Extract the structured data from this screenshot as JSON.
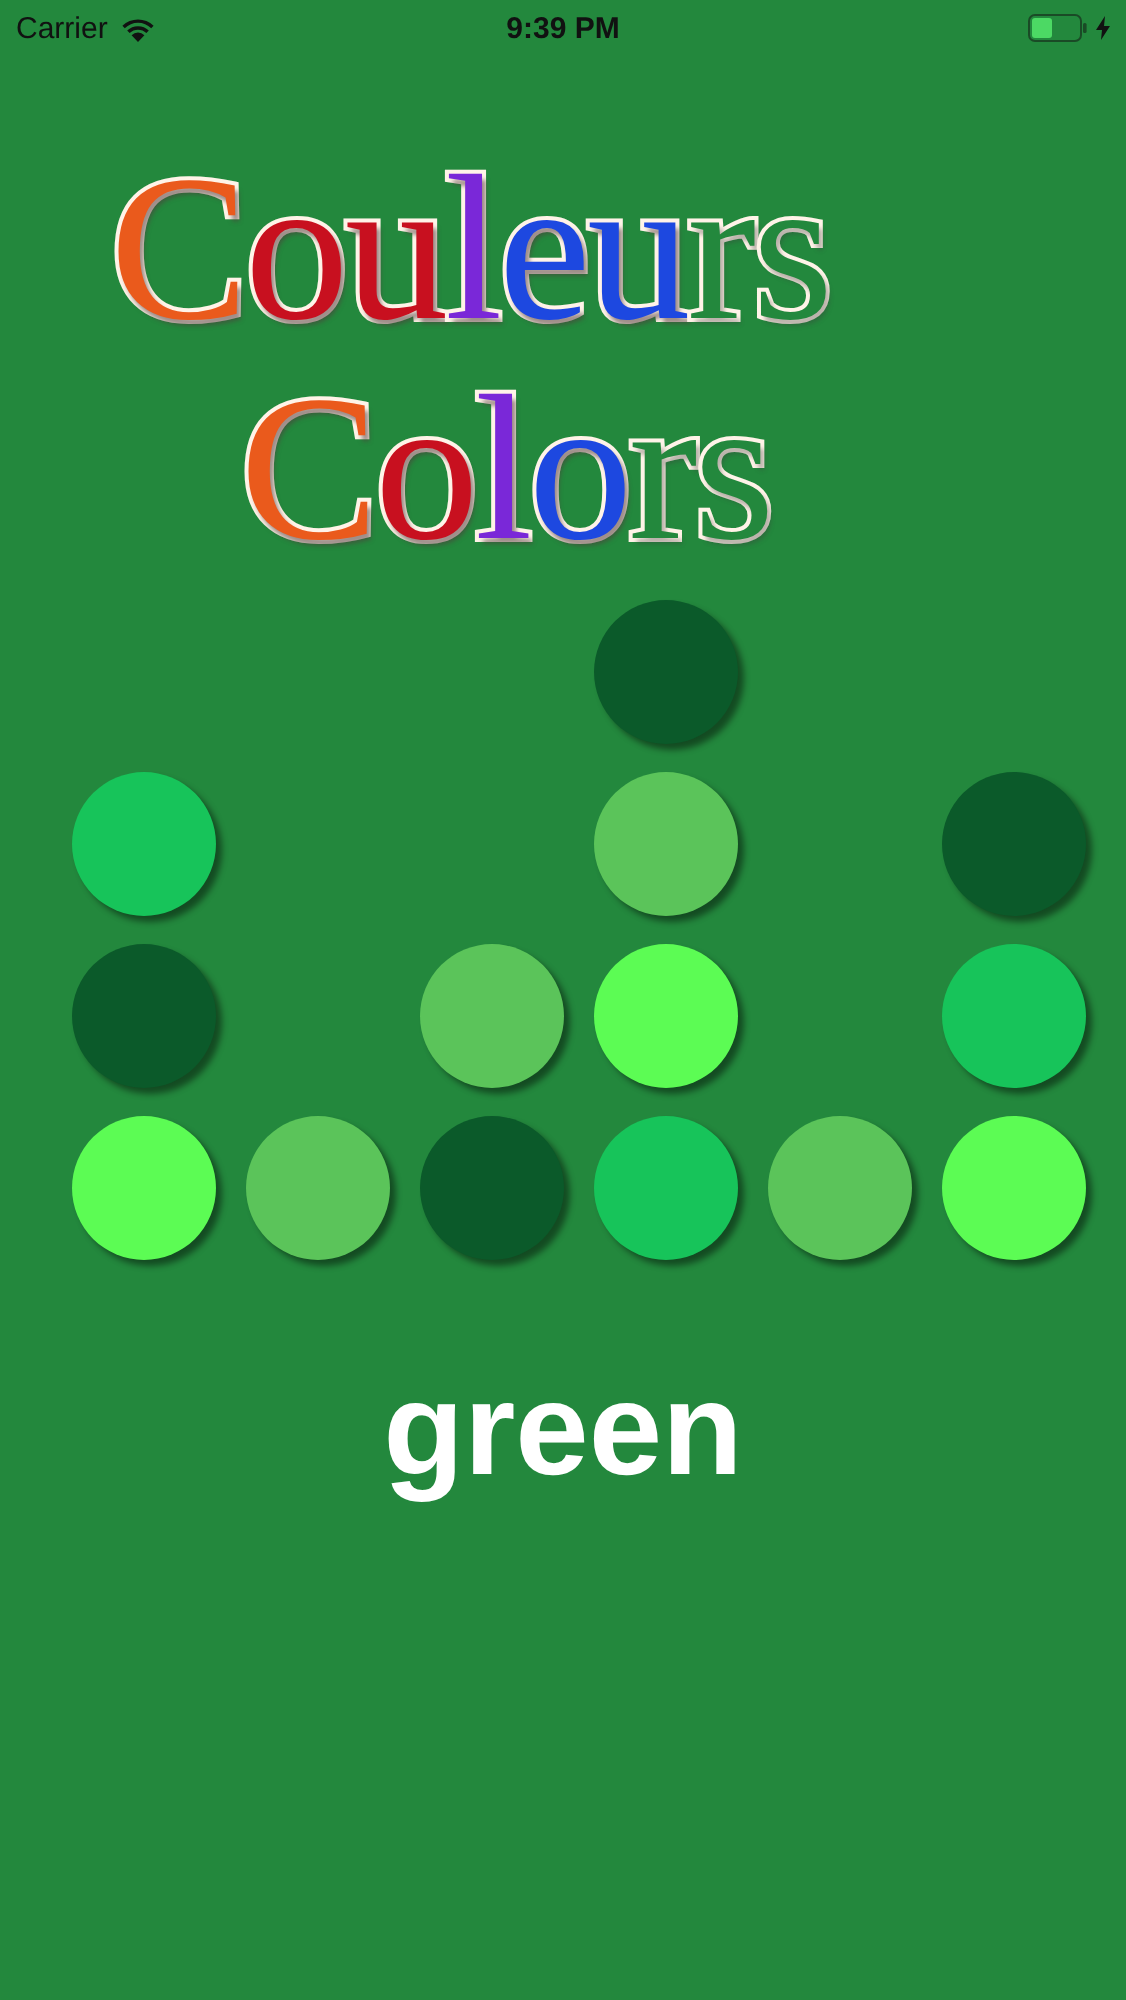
{
  "status_bar": {
    "carrier": "Carrier",
    "time": "9:39 PM",
    "charging": true
  },
  "logo": {
    "lines": [
      {
        "letters": [
          {
            "char": "C",
            "color": "#ea5a1c",
            "outline": false
          },
          {
            "char": "o",
            "color": "#c8101f",
            "outline": false
          },
          {
            "char": "u",
            "color": "#c8101f",
            "outline": false
          },
          {
            "char": "l",
            "color": "#7a28d8",
            "outline": false
          },
          {
            "char": "e",
            "color": "#1d48e0",
            "outline": false
          },
          {
            "char": "u",
            "color": "#1d48e0",
            "outline": false
          },
          {
            "char": "r",
            "color": "#23883d",
            "outline": true
          },
          {
            "char": "s",
            "color": "#23883d",
            "outline": true
          }
        ]
      },
      {
        "letters": [
          {
            "char": "C",
            "color": "#ea5a1c",
            "outline": false
          },
          {
            "char": "o",
            "color": "#c8101f",
            "outline": false
          },
          {
            "char": "l",
            "color": "#7a28d8",
            "outline": false
          },
          {
            "char": "o",
            "color": "#1d48e0",
            "outline": false
          },
          {
            "char": "r",
            "color": "#23883d",
            "outline": true
          },
          {
            "char": "s",
            "color": "#23883d",
            "outline": true
          }
        ]
      }
    ]
  },
  "grid": [
    [
      {
        "kind": "empty"
      },
      {
        "kind": "empty"
      },
      {
        "kind": "empty"
      },
      {
        "kind": "dot",
        "color": "#0b5a2a"
      },
      {
        "kind": "empty"
      },
      {
        "kind": "empty"
      }
    ],
    [
      {
        "kind": "dot",
        "color": "#17c45a"
      },
      {
        "kind": "empty"
      },
      {
        "kind": "empty"
      },
      {
        "kind": "dot",
        "color": "#5bc45a"
      },
      {
        "kind": "empty"
      },
      {
        "kind": "dot",
        "color": "#0b5a2a"
      }
    ],
    [
      {
        "kind": "dot",
        "color": "#0b5a2a"
      },
      {
        "kind": "empty"
      },
      {
        "kind": "dot",
        "color": "#5bc45a"
      },
      {
        "kind": "dot",
        "color": "#5cfc54"
      },
      {
        "kind": "empty"
      },
      {
        "kind": "dot",
        "color": "#17c45a"
      }
    ],
    [
      {
        "kind": "dot",
        "color": "#5cfc54"
      },
      {
        "kind": "dot",
        "color": "#5bc45a"
      },
      {
        "kind": "dot",
        "color": "#0b5a2a"
      },
      {
        "kind": "dot",
        "color": "#17c45a"
      },
      {
        "kind": "dot",
        "color": "#5bc45a"
      },
      {
        "kind": "dot",
        "color": "#5cfc54"
      }
    ]
  ],
  "word": "green"
}
